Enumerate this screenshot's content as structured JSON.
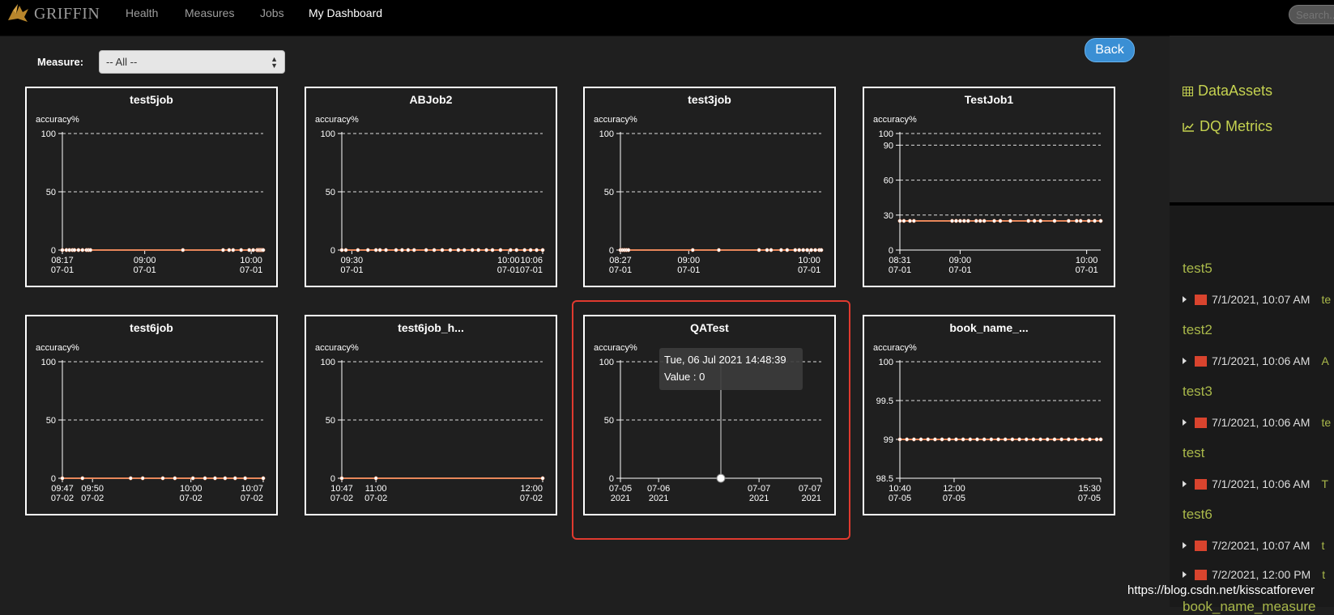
{
  "nav": {
    "logo_text": "GRIFFIN",
    "items": [
      {
        "label": "Health",
        "active": false
      },
      {
        "label": "Measures",
        "active": false
      },
      {
        "label": "Jobs",
        "active": false
      },
      {
        "label": "My Dashboard",
        "active": true
      }
    ],
    "search_placeholder": "Search..."
  },
  "toolbar": {
    "measure_label": "Measure:",
    "measure_value": "-- All --",
    "back_label": "Back"
  },
  "colors": {
    "line": "#e8875a",
    "highlight": "#e03a2f",
    "back": "#3a8fd4",
    "sidebar_link": "#c5d250",
    "sidebar_measure": "#a9b84a"
  },
  "chart_data": [
    {
      "type": "line",
      "title": "test5job",
      "ylabel": "accuracy%",
      "ylim": [
        0,
        100
      ],
      "yticks": [
        0,
        50,
        100
      ],
      "xticks": [
        {
          "pos": 0,
          "l1": "08:17",
          "l2": "07-01"
        },
        {
          "pos": 0.41,
          "l1": "09:00",
          "l2": "07-01"
        },
        {
          "pos": 0.94,
          "l1": "10:00",
          "l2": "07-01"
        }
      ],
      "x": [
        0.0,
        0.02,
        0.035,
        0.05,
        0.06,
        0.08,
        0.1,
        0.12,
        0.13,
        0.14,
        0.6,
        0.8,
        0.83,
        0.85,
        0.89,
        0.93,
        0.95,
        0.97,
        1.0,
        0.995,
        0.99,
        0.985,
        0.98,
        0.975,
        0.97
      ],
      "values": [
        0,
        0,
        0,
        0,
        0,
        0,
        0,
        0,
        0,
        0,
        0,
        0,
        0,
        0,
        0,
        0,
        0,
        0,
        0,
        0,
        0,
        0,
        0,
        0,
        0
      ]
    },
    {
      "type": "line",
      "title": "ABJob2",
      "ylabel": "accuracy%",
      "ylim": [
        0,
        100
      ],
      "yticks": [
        0,
        50,
        100
      ],
      "xticks": [
        {
          "pos": 0.05,
          "l1": "09:30",
          "l2": "07-01"
        },
        {
          "pos": 0.83,
          "l1": "10:00",
          "l2": "07-01"
        },
        {
          "pos": 1.0,
          "l1": "10:06",
          "l2": "07-01"
        }
      ],
      "x": [
        0.0,
        0.02,
        0.08,
        0.13,
        0.17,
        0.19,
        0.22,
        0.27,
        0.3,
        0.33,
        0.36,
        0.42,
        0.46,
        0.5,
        0.54,
        0.58,
        0.61,
        0.65,
        0.68,
        0.72,
        0.75,
        0.79,
        0.84,
        0.87,
        0.91,
        0.94,
        0.97,
        1.0
      ],
      "values": [
        0,
        0,
        0,
        0,
        0,
        0,
        0,
        0,
        0,
        0,
        0,
        0,
        0,
        0,
        0,
        0,
        0,
        0,
        0,
        0,
        0,
        0,
        0,
        0,
        0,
        0,
        0,
        0
      ]
    },
    {
      "type": "line",
      "title": "test3job",
      "ylabel": "accuracy%",
      "ylim": [
        0,
        100
      ],
      "yticks": [
        0,
        50,
        100
      ],
      "xticks": [
        {
          "pos": 0,
          "l1": "08:27",
          "l2": "07-01"
        },
        {
          "pos": 0.34,
          "l1": "09:00",
          "l2": "07-01"
        },
        {
          "pos": 0.94,
          "l1": "10:00",
          "l2": "07-01"
        }
      ],
      "x": [
        0.0,
        0.01,
        0.02,
        0.03,
        0.04,
        0.36,
        0.49,
        0.69,
        0.73,
        0.75,
        0.8,
        0.83,
        0.87,
        0.89,
        0.91,
        0.93,
        0.95,
        0.97,
        0.99,
        1.0
      ],
      "values": [
        0,
        0,
        0,
        0,
        0,
        0,
        0,
        0,
        0,
        0,
        0,
        0,
        0,
        0,
        0,
        0,
        0,
        0,
        0,
        0
      ]
    },
    {
      "type": "line",
      "title": "TestJob1",
      "ylabel": "accuracy%",
      "ylim": [
        0,
        100
      ],
      "yticks": [
        0,
        30,
        60,
        90,
        100
      ],
      "xticks": [
        {
          "pos": 0,
          "l1": "08:31",
          "l2": "07-01"
        },
        {
          "pos": 0.3,
          "l1": "09:00",
          "l2": "07-01"
        },
        {
          "pos": 0.93,
          "l1": "10:00",
          "l2": "07-01"
        }
      ],
      "x": [
        0.0,
        0.02,
        0.05,
        0.07,
        0.26,
        0.28,
        0.3,
        0.32,
        0.34,
        0.38,
        0.4,
        0.42,
        0.47,
        0.5,
        0.55,
        0.64,
        0.67,
        0.7,
        0.77,
        0.84,
        0.88,
        0.9,
        0.94,
        0.97,
        1.0
      ],
      "values": [
        25,
        25,
        25,
        25,
        25,
        25,
        25,
        25,
        25,
        25,
        25,
        25,
        25,
        25,
        25,
        25,
        25,
        25,
        25,
        25,
        25,
        25,
        25,
        25,
        25
      ]
    },
    {
      "type": "line",
      "title": "test6job",
      "ylabel": "accuracy%",
      "ylim": [
        0,
        100
      ],
      "yticks": [
        0,
        50,
        100
      ],
      "xticks": [
        {
          "pos": 0,
          "l1": "09:47",
          "l2": "07-02"
        },
        {
          "pos": 0.15,
          "l1": "09:50",
          "l2": "07-02"
        },
        {
          "pos": 0.64,
          "l1": "10:00",
          "l2": "07-02"
        },
        {
          "pos": 1.0,
          "l1": "10:07",
          "l2": "07-02"
        }
      ],
      "x": [
        0.0,
        0.1,
        0.34,
        0.4,
        0.5,
        0.56,
        0.65,
        0.71,
        0.76,
        0.81,
        0.86,
        0.91,
        1.0
      ],
      "values": [
        0,
        0,
        0,
        0,
        0,
        0,
        0,
        0,
        0,
        0,
        0,
        0,
        0
      ]
    },
    {
      "type": "line",
      "title": "test6job_h...",
      "ylabel": "accuracy%",
      "ylim": [
        0,
        100
      ],
      "yticks": [
        0,
        50,
        100
      ],
      "xticks": [
        {
          "pos": 0,
          "l1": "10:47",
          "l2": "07-02"
        },
        {
          "pos": 0.17,
          "l1": "11:00",
          "l2": "07-02"
        },
        {
          "pos": 1.0,
          "l1": "12:00",
          "l2": "07-02"
        }
      ],
      "x": [
        0.0,
        0.17,
        1.0
      ],
      "values": [
        0,
        0,
        0
      ]
    },
    {
      "type": "line",
      "title": "QATest",
      "ylabel": "accuracy%",
      "ylim": [
        0,
        100
      ],
      "yticks": [
        0,
        50,
        100
      ],
      "xticks": [
        {
          "pos": 0,
          "l1": "07-05",
          "l2": "2021"
        },
        {
          "pos": 0.19,
          "l1": "07-06",
          "l2": "2021"
        },
        {
          "pos": 0.69,
          "l1": "07-07",
          "l2": "2021"
        },
        {
          "pos": 1.0,
          "l1": "07-07",
          "l2": "2021"
        }
      ],
      "x": [
        0.5
      ],
      "values": [
        0
      ],
      "tooltip": {
        "date": "Tue, 06 Jul 2021 14:48:39",
        "value": "Value : 0",
        "x": 0.5
      }
    },
    {
      "type": "line",
      "title": "book_name_...",
      "ylabel": "accuracy%",
      "ylim": [
        98.5,
        100
      ],
      "yticks": [
        98.5,
        99,
        99.5,
        100
      ],
      "xticks": [
        {
          "pos": 0,
          "l1": "10:40",
          "l2": "07-05"
        },
        {
          "pos": 0.27,
          "l1": "12:00",
          "l2": "07-05"
        },
        {
          "pos": 1.0,
          "l1": "15:30",
          "l2": "07-05"
        }
      ],
      "x": [
        0.0,
        0.035,
        0.07,
        0.105,
        0.14,
        0.175,
        0.21,
        0.245,
        0.28,
        0.315,
        0.35,
        0.385,
        0.42,
        0.455,
        0.49,
        0.525,
        0.56,
        0.595,
        0.63,
        0.665,
        0.7,
        0.735,
        0.77,
        0.805,
        0.84,
        0.875,
        0.91,
        0.945,
        0.98,
        1.0
      ],
      "values": [
        99,
        99,
        99,
        99,
        99,
        99,
        99,
        99,
        99,
        99,
        99,
        99,
        99,
        99,
        99,
        99,
        99,
        99,
        99,
        99,
        99,
        99,
        99,
        99,
        99,
        99,
        99,
        99,
        99,
        99
      ]
    }
  ],
  "sidebar": {
    "links": [
      {
        "label": "DataAssets",
        "icon": "table-icon"
      },
      {
        "label": "DQ Metrics",
        "icon": "line-chart-icon"
      }
    ],
    "groups": [
      {
        "name": "test5",
        "rows": [
          {
            "date": "7/1/2021, 10:07 AM",
            "extra": "te"
          }
        ]
      },
      {
        "name": "test2",
        "rows": [
          {
            "date": "7/1/2021, 10:06 AM",
            "extra": "A"
          }
        ]
      },
      {
        "name": "test3",
        "rows": [
          {
            "date": "7/1/2021, 10:06 AM",
            "extra": "te"
          }
        ]
      },
      {
        "name": "test",
        "rows": [
          {
            "date": "7/1/2021, 10:06 AM",
            "extra": "T"
          }
        ]
      },
      {
        "name": "test6",
        "rows": [
          {
            "date": "7/2/2021, 10:07 AM",
            "extra": "t"
          },
          {
            "date": "7/2/2021, 12:00 PM",
            "extra": "t"
          }
        ]
      }
    ],
    "cut_measure": "book_name_measure"
  },
  "watermark": "https://blog.csdn.net/kisscatforever"
}
